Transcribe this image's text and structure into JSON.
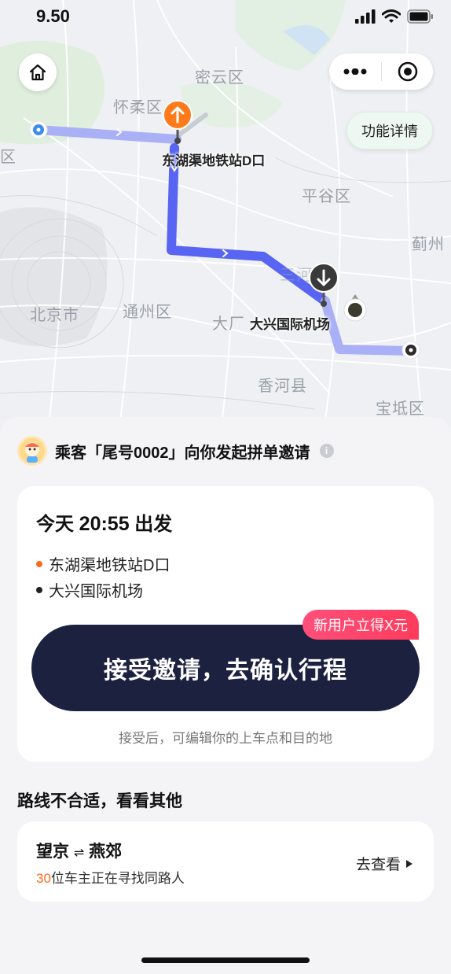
{
  "status_bar": {
    "time": "9.50"
  },
  "map": {
    "districts": [
      "密云区",
      "怀柔区",
      "平谷区",
      "蓟州",
      "北京市",
      "通州区",
      "三河市",
      "大厂",
      "香河县",
      "宝坻区",
      "区"
    ],
    "pickup_label": "东湖渠地铁站D口",
    "dropoff_label": "大兴国际机场",
    "function_button": "功能详情"
  },
  "invite": {
    "text": "乘客「尾号0002」向你发起拼单邀请",
    "info": "i"
  },
  "trip": {
    "depart_prefix": "今天",
    "depart_time": "20:55",
    "depart_suffix": "出发",
    "from": "东湖渠地铁站D口",
    "to": "大兴国际机场",
    "badge": "新用户立得X元",
    "accept_button": "接受邀请，去确认行程",
    "hint": "接受后，可编辑你的上车点和目的地"
  },
  "other": {
    "section_title": "路线不合适，看看其他",
    "route_from": "望京",
    "route_arrow": "⇌",
    "route_to": "燕郊",
    "count": "30",
    "count_text": "位车主正在寻找同路人",
    "link": "去查看"
  },
  "colors": {
    "route": "#5865f2",
    "accent_orange": "#ff6a1a",
    "button_dark": "#1c2140",
    "badge_pink": "#ff4f7a"
  }
}
